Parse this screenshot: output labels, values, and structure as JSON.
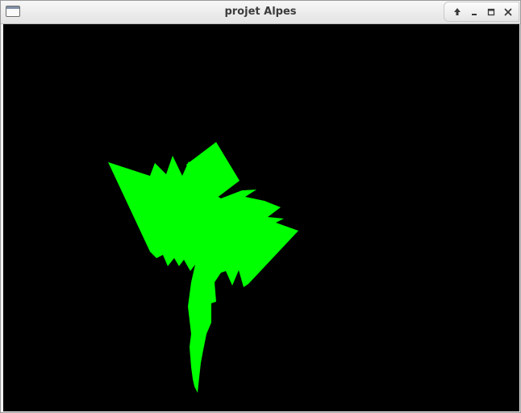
{
  "window": {
    "title": "projet Alpes",
    "controls": [
      {
        "name": "shade-icon"
      },
      {
        "name": "minimize-icon"
      },
      {
        "name": "maximize-icon"
      },
      {
        "name": "close-icon"
      }
    ]
  },
  "colors": {
    "canvas_background": "#000000",
    "terrain_fill": "#00ff00",
    "titlebar": "#e9e9e9",
    "title_text": "#3c3c3c"
  }
}
